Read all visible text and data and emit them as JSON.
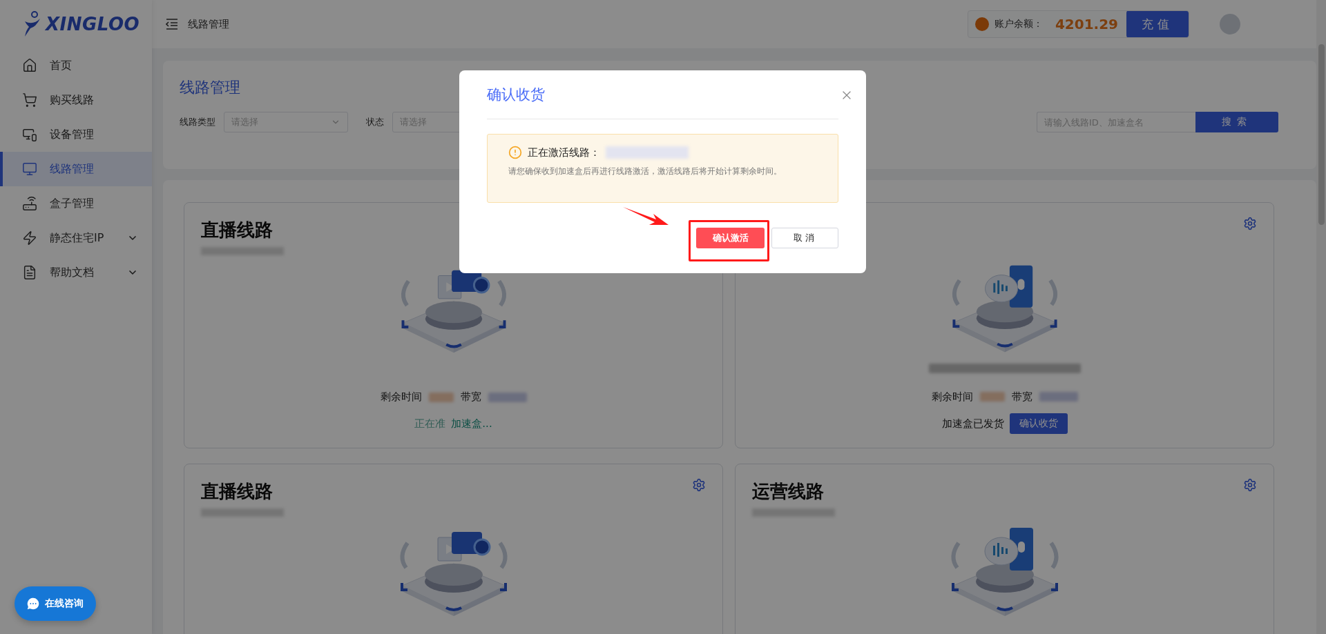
{
  "brand": {
    "name": "XINGLOO"
  },
  "sidebar": {
    "items": [
      {
        "label": "首页",
        "kind": "link",
        "selected": false
      },
      {
        "label": "购买线路",
        "kind": "link",
        "selected": false
      },
      {
        "label": "设备管理",
        "kind": "link",
        "selected": false
      },
      {
        "label": "线路管理",
        "kind": "link",
        "selected": true
      },
      {
        "label": "盒子管理",
        "kind": "link",
        "selected": false
      },
      {
        "label": "静态住宅IP",
        "kind": "submenu",
        "selected": false
      },
      {
        "label": "帮助文档",
        "kind": "submenu",
        "selected": false
      }
    ]
  },
  "header": {
    "breadcrumb": "线路管理",
    "balance_label": "账户余额：",
    "balance": "4201.29",
    "recharge_button": "充值"
  },
  "filters": {
    "title": "线路管理",
    "fields": [
      {
        "label": "线路类型",
        "placeholder": "请选择"
      },
      {
        "label": "状态",
        "placeholder": "请选择"
      }
    ],
    "search": {
      "placeholder": "请输入线路ID、加速盒名",
      "button": "搜索"
    }
  },
  "cards": [
    {
      "title": "直播线路",
      "kind": "live",
      "settings": false,
      "info": {
        "time_label": "剩余时间",
        "bandwidth_label": "带宽"
      },
      "status": {
        "kind": "preparing",
        "prefix": "正在准",
        "text": "加速盒..."
      }
    },
    {
      "kind": "ops",
      "settings": true,
      "info": {
        "time_label": "剩余时间",
        "bandwidth_label": "带宽"
      },
      "status": {
        "kind": "shipped",
        "text": "加速盒已发货",
        "button": "确认收货"
      }
    },
    {
      "title": "直播线路",
      "kind": "live",
      "settings": true
    },
    {
      "title": "运营线路",
      "kind": "ops",
      "settings": true
    }
  ],
  "chat_button": "在线咨询",
  "dialog": {
    "title": "确认收货",
    "notice_title": "正在激活线路：",
    "notice_text": "请您确保收到加速盒后再进行线路激活，激活线路后将开始计算剩余时间。",
    "confirm_button": "确认激活",
    "cancel_button": "取消"
  }
}
